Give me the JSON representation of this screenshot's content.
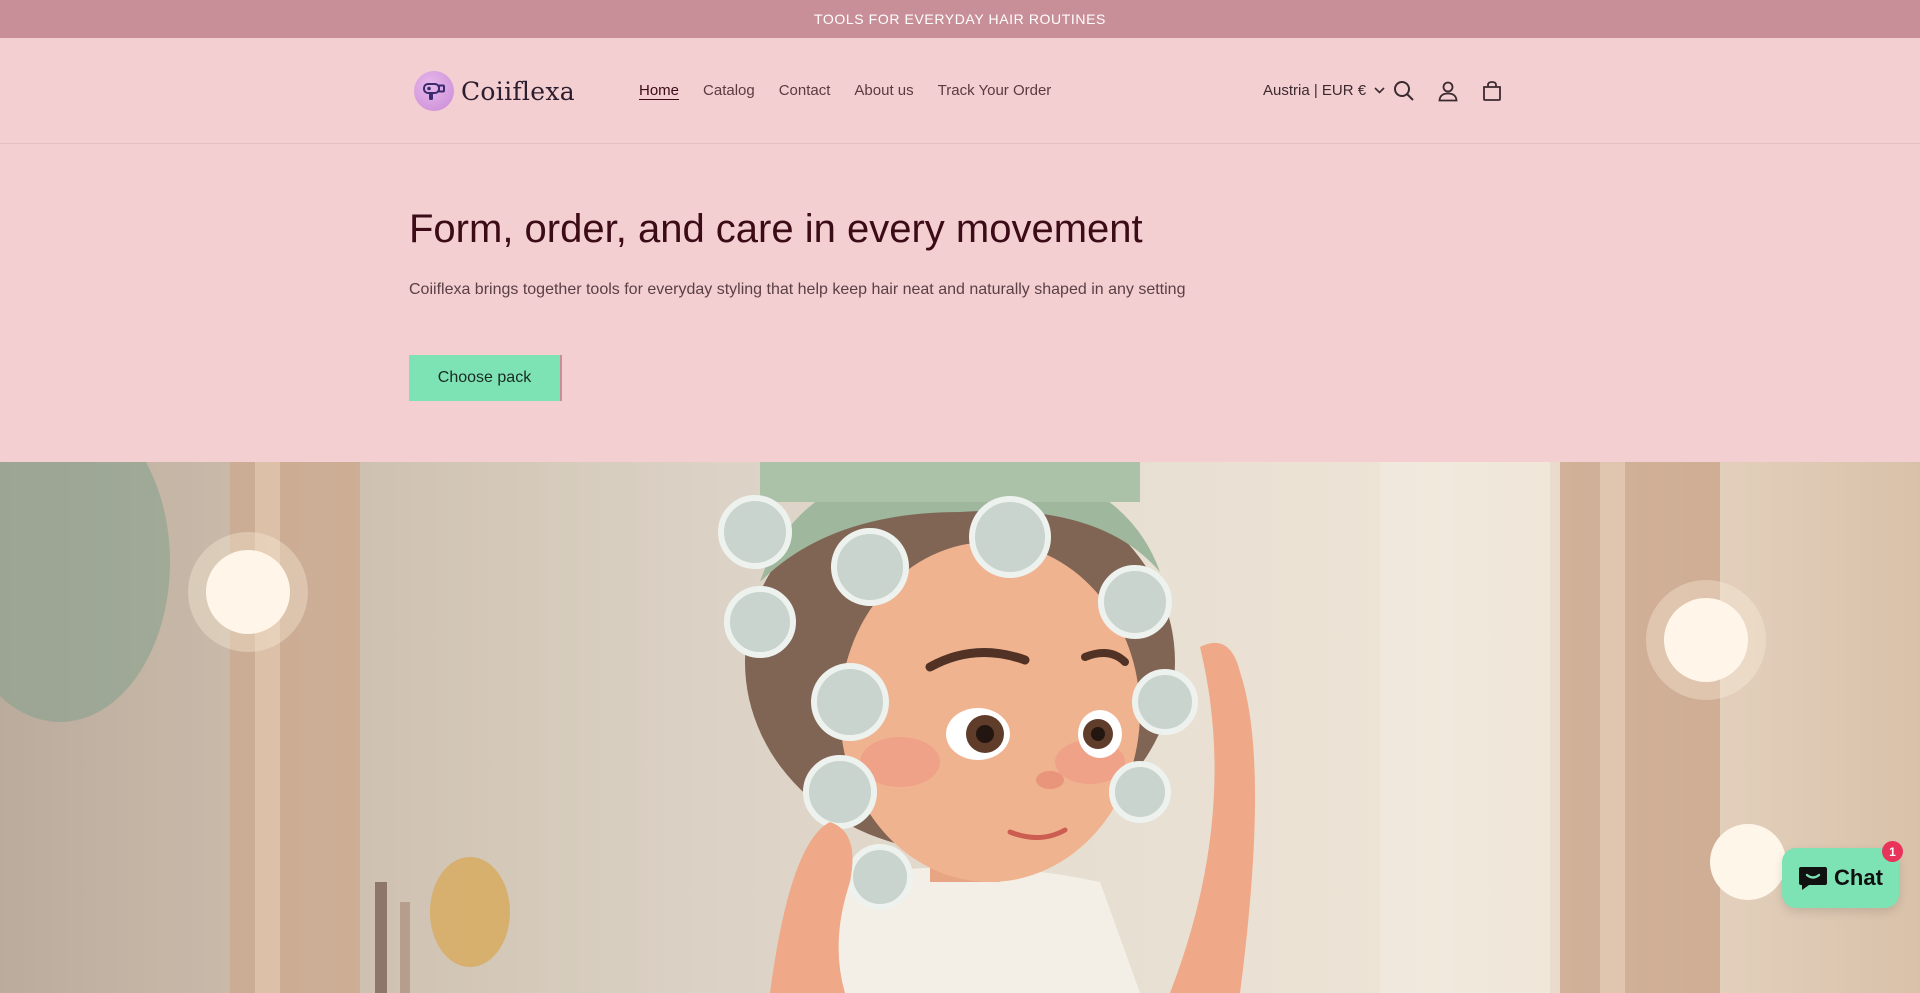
{
  "announcement": {
    "text": "TOOLS FOR EVERYDAY HAIR ROUTINES"
  },
  "header": {
    "logo_text": "Coiiflexa",
    "nav": [
      {
        "label": "Home",
        "active": true
      },
      {
        "label": "Catalog"
      },
      {
        "label": "Contact"
      },
      {
        "label": "About us"
      },
      {
        "label": "Track Your Order"
      }
    ],
    "locale": "Austria | EUR €",
    "icons": [
      "search-icon",
      "account-icon",
      "cart-icon"
    ]
  },
  "hero": {
    "title": "Form, order, and care in every movement",
    "subtitle": "Coiiflexa brings together tools for everyday styling that help keep hair neat and naturally shaped in any setting",
    "cta_label": "Choose pack"
  },
  "chat": {
    "label": "Chat",
    "badge_count": "1"
  },
  "colors": {
    "announcement_bg": "#c98f98",
    "page_bg": "#f3cfd2",
    "accent": "#7ee3b4",
    "title_color": "#3b0b16",
    "badge": "#e8335a"
  }
}
